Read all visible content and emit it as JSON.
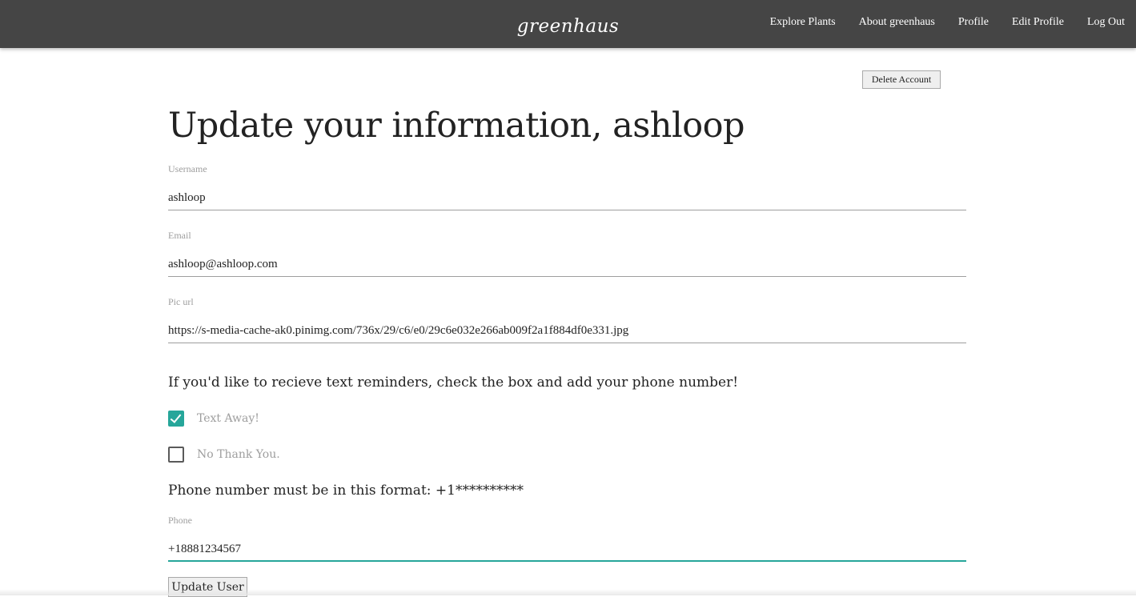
{
  "navbar": {
    "brand": "greenhaus",
    "links": [
      {
        "label": "Explore Plants"
      },
      {
        "label": "About greenhaus"
      },
      {
        "label": "Profile"
      },
      {
        "label": "Edit Profile"
      },
      {
        "label": "Log Out"
      }
    ]
  },
  "actions": {
    "delete_label": "Delete Account",
    "update_label": "Update User"
  },
  "form": {
    "title": "Update your information, ashloop",
    "username": {
      "label": "Username",
      "value": "ashloop"
    },
    "email": {
      "label": "Email",
      "value": "ashloop@ashloop.com"
    },
    "pic_url": {
      "label": "Pic url",
      "value": "https://s-media-cache-ak0.pinimg.com/736x/29/c6/e0/29c6e032e266ab009f2a1f884df0e331.jpg"
    },
    "reminder_prompt": "If you'd like to recieve text reminders, check the box and add your phone number!",
    "options": [
      {
        "label": "Text Away!",
        "checked": true
      },
      {
        "label": "No Thank You.",
        "checked": false
      }
    ],
    "phone_format_note": "Phone number must be in this format: +1**********",
    "phone": {
      "label": "Phone",
      "value": "+18881234567"
    }
  },
  "colors": {
    "navbar_bg": "#454545",
    "accent": "#26a69a",
    "label_gray": "#9e9e9e"
  }
}
